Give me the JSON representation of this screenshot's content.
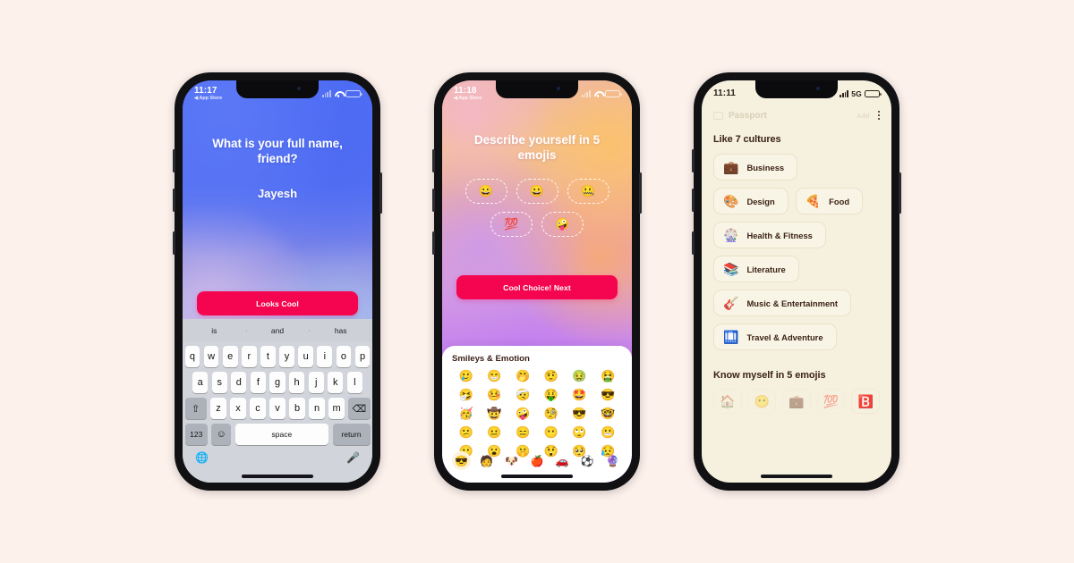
{
  "page": {
    "background_color": "#FDF1EC",
    "accent_color": "#F5054F"
  },
  "phones": [
    {
      "id": "phone-1",
      "status_bar": {
        "time": "11:17",
        "back_label": "App Store",
        "carrier": "",
        "signal_icon": "signal-bars-icon",
        "wifi_icon": "wifi-icon",
        "battery_icon": "battery-icon",
        "battery_color": "#e8323c"
      },
      "screen": {
        "question": "What is your full name, friend?",
        "answer": "Jayesh",
        "cta_label": "Looks Cool"
      },
      "keyboard": {
        "suggestions": [
          "is",
          "and",
          "has"
        ],
        "row1": [
          "q",
          "w",
          "e",
          "r",
          "t",
          "y",
          "u",
          "i",
          "o",
          "p"
        ],
        "row2": [
          "a",
          "s",
          "d",
          "f",
          "g",
          "h",
          "j",
          "k",
          "l"
        ],
        "shift_icon": "shift-arrow-icon",
        "row3": [
          "z",
          "x",
          "c",
          "v",
          "b",
          "n",
          "m"
        ],
        "backspace_icon": "backspace-icon",
        "numbers_key": "123",
        "emoji_key_icon": "smiley-icon",
        "space_key": "space",
        "return_key": "return",
        "globe_icon": "globe-icon",
        "mic_icon": "microphone-icon"
      }
    },
    {
      "id": "phone-2",
      "status_bar": {
        "time": "11:18",
        "back_label": "App Store",
        "signal_icon": "signal-bars-icon",
        "wifi_icon": "wifi-icon",
        "battery_icon": "battery-icon",
        "battery_color": "#e8323c"
      },
      "screen": {
        "title": "Describe yourself in 5 emojis",
        "selected_emojis": [
          "😀",
          "😀",
          "🤐",
          "💯",
          "🤪"
        ],
        "cta_label": "Cool Choice! Next"
      },
      "emoji_picker": {
        "section_title": "Smileys & Emotion",
        "grid": [
          "🥲",
          "😁",
          "🤭",
          "🤨",
          "🤢",
          "🤮",
          "🤧",
          "🤒",
          "🤕",
          "🤑",
          "🤩",
          "😎",
          "🥳",
          "🤠",
          "🤪",
          "🧐",
          "😎",
          "🤓",
          "😕",
          "😐",
          "😑",
          "😶",
          "🙄",
          "😬",
          "😶",
          "😮",
          "🤫",
          "😲",
          "🥺",
          "😥"
        ],
        "tabs": [
          {
            "icon": "😎",
            "name": "smileys-tab",
            "selected": true
          },
          {
            "icon": "🧑",
            "name": "people-tab",
            "selected": false
          },
          {
            "icon": "🐶",
            "name": "animals-tab",
            "selected": false
          },
          {
            "icon": "🍎",
            "name": "food-tab",
            "selected": false
          },
          {
            "icon": "🚗",
            "name": "travel-tab",
            "selected": false
          },
          {
            "icon": "⚽",
            "name": "activity-tab",
            "selected": false
          },
          {
            "icon": "🔮",
            "name": "objects-tab",
            "selected": false
          }
        ]
      }
    },
    {
      "id": "phone-3",
      "status_bar": {
        "time": "11:11",
        "network": "5G",
        "signal_icon": "signal-bars-icon",
        "battery_icon": "battery-icon",
        "battery_color": "#2a2018"
      },
      "header": {
        "icon": "passport-icon",
        "title": "Passport",
        "add_label": "Add",
        "menu_icon": "kebab-menu-icon"
      },
      "sections": [
        {
          "heading": "Like 7 cultures",
          "chips": [
            {
              "emoji": "💼",
              "label": "Business"
            },
            {
              "emoji": "🎨",
              "label": "Design"
            },
            {
              "emoji": "🍕",
              "label": "Food"
            },
            {
              "emoji": "🎡",
              "label": "Health & Fitness"
            },
            {
              "emoji": "📚",
              "label": "Literature"
            },
            {
              "emoji": "🎸",
              "label": "Music & Entertainment"
            },
            {
              "emoji": "🛄",
              "label": "Travel & Adventure"
            }
          ],
          "chip_rows": [
            [
              0
            ],
            [
              1,
              2
            ],
            [
              3
            ],
            [
              4
            ],
            [
              5
            ],
            [
              6
            ]
          ]
        },
        {
          "heading": "Know myself in 5 emojis",
          "emoji_slots": [
            {
              "emoji": "🏠",
              "strong": false
            },
            {
              "emoji": "😶",
              "strong": false
            },
            {
              "emoji": "💼",
              "strong": false
            },
            {
              "emoji": "💯",
              "strong": false
            },
            {
              "emoji": "🅱️",
              "strong": true
            }
          ]
        }
      ]
    }
  ]
}
